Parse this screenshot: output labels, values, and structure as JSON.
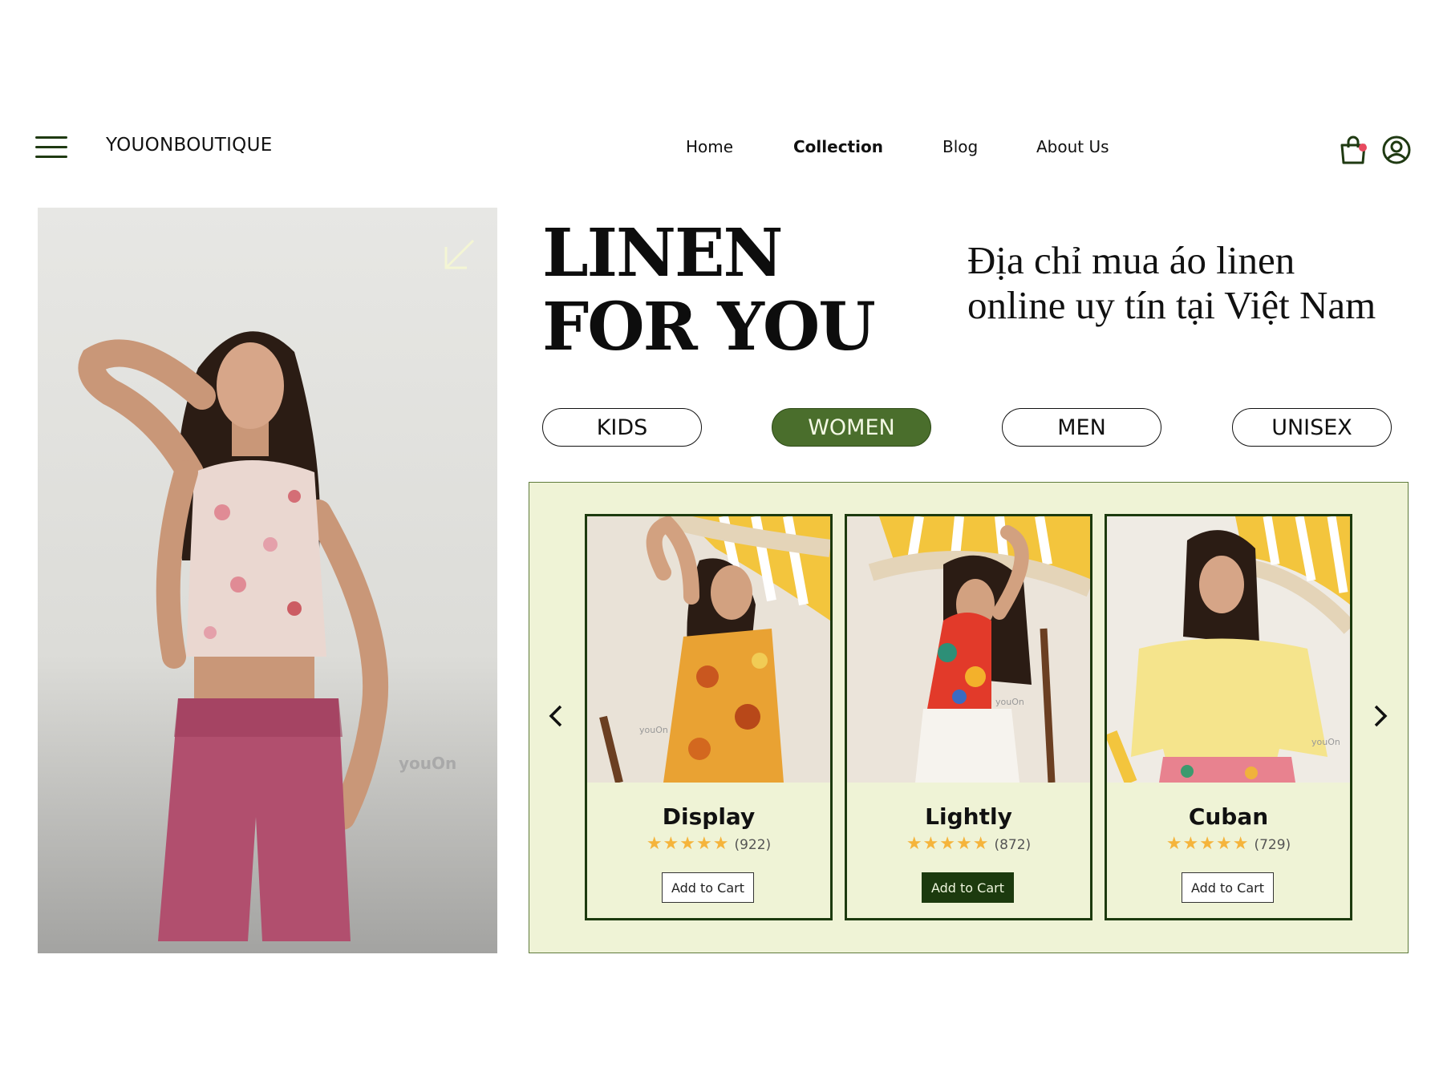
{
  "header": {
    "brand": "YOUONBOUTIQUE",
    "nav": [
      {
        "label": "Home",
        "active": false
      },
      {
        "label": "Collection",
        "active": true
      },
      {
        "label": "Blog",
        "active": false
      },
      {
        "label": "About Us",
        "active": false
      }
    ]
  },
  "hero": {
    "headline_line1": "LINEN",
    "headline_line2": "FOR YOU",
    "tagline_line1": "Địa chỉ mua áo linen",
    "tagline_line2": "online uy tín tại Việt Nam",
    "photo_watermark": "youOn"
  },
  "categories": [
    {
      "label": "KIDS",
      "active": false
    },
    {
      "label": "WOMEN",
      "active": true
    },
    {
      "label": "MEN",
      "active": false
    },
    {
      "label": "UNISEX",
      "active": false
    }
  ],
  "products": [
    {
      "name": "Display",
      "stars": "★★★★★",
      "reviews": "(922)",
      "button": "Add to Cart",
      "watermark": "youOn",
      "rating": 5
    },
    {
      "name": "Lightly",
      "stars": "★★★★★",
      "reviews": "(872)",
      "button": "Add to Cart",
      "watermark": "youOn",
      "rating": 5
    },
    {
      "name": "Cuban",
      "stars": "★★★★★",
      "reviews": "(729)",
      "button": "Add to Cart",
      "watermark": "youOn",
      "rating": 5
    }
  ],
  "colors": {
    "accent_green": "#4a6e2c",
    "dark_green": "#1c3a0e",
    "panel_bg": "#eff3d6",
    "star": "#f5b43c",
    "cart_dot": "#e84a5f"
  },
  "icons": [
    "menu-icon",
    "shopping-bag-icon",
    "user-account-icon",
    "arrow-down-left-icon",
    "chevron-left-icon",
    "chevron-right-icon"
  ]
}
